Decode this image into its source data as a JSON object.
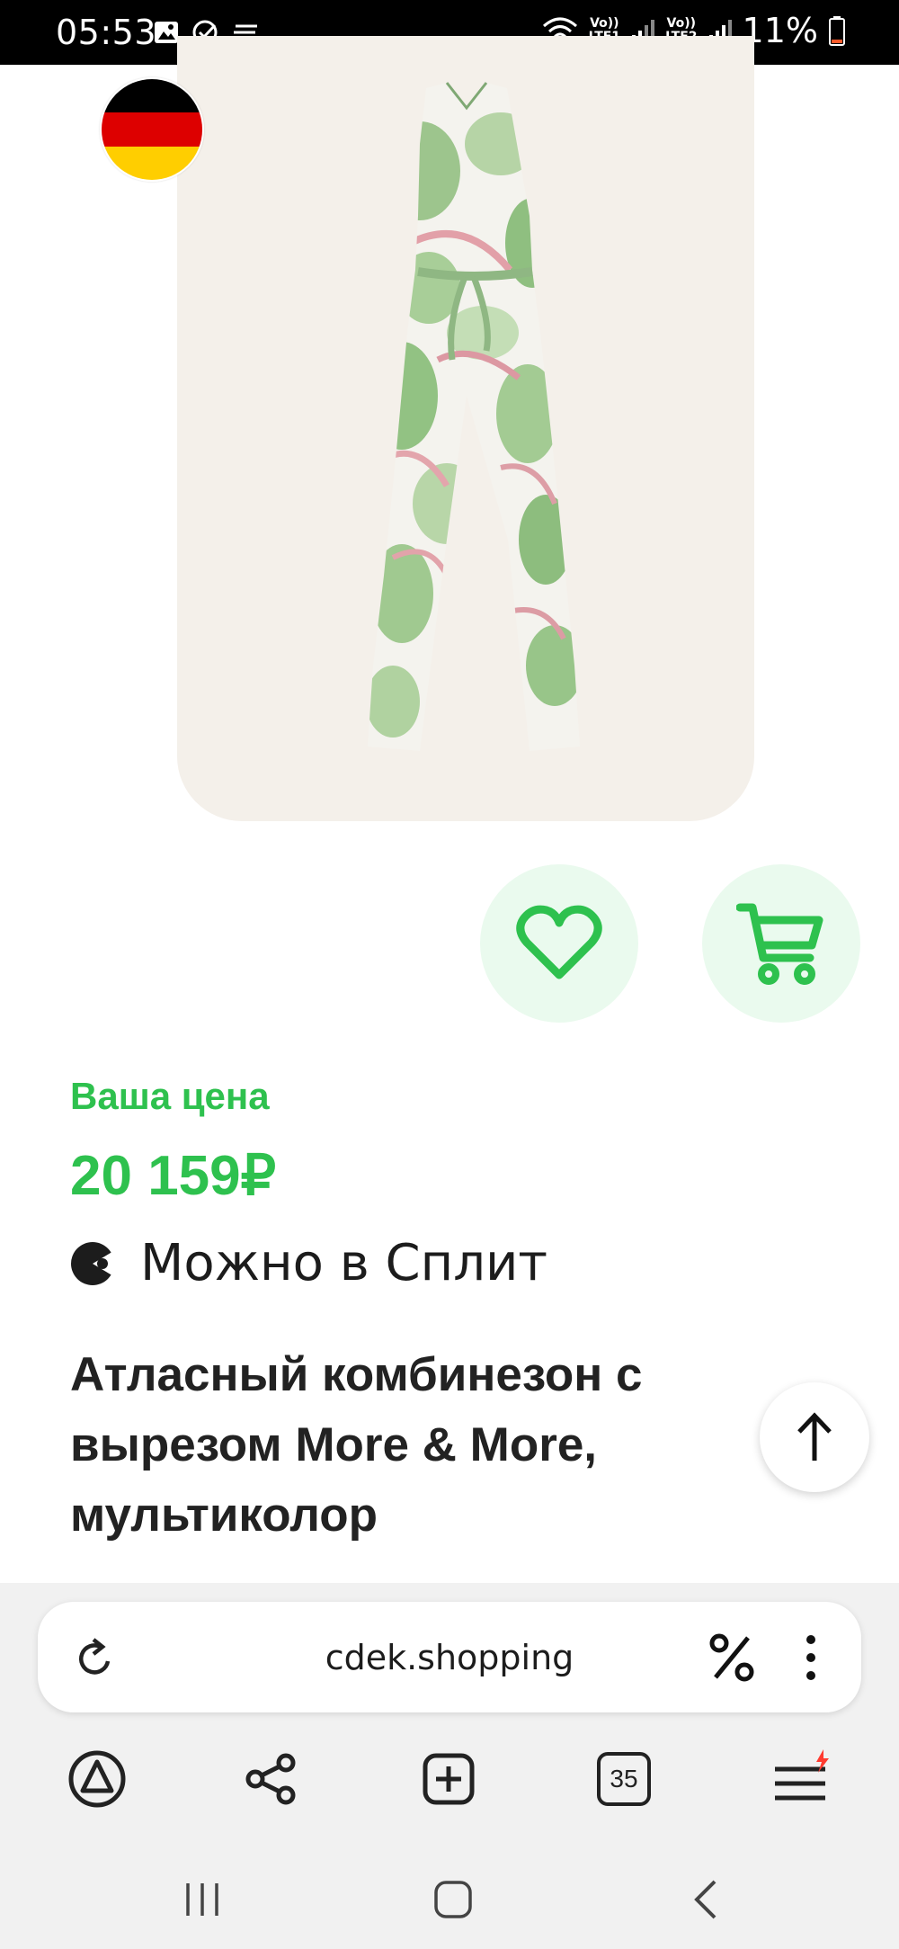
{
  "status_bar": {
    "time": "05:53",
    "battery": "11%",
    "sim1": "LTE1",
    "sim2": "LTE2",
    "volte": "Vo))"
  },
  "product": {
    "price_label": "Ваша цена",
    "price": "20 159₽",
    "split_text": "Можно в Сплит",
    "title": "Атласный комбинезон с вырезом More & More, мультиколор",
    "origin_flag": "germany-flag-icon"
  },
  "browser": {
    "url": "cdek.shopping",
    "tab_count": "35"
  },
  "colors": {
    "accent_green": "#2ec14e",
    "button_bg": "#eafaee",
    "notification_red": "#ff3b30"
  },
  "icons": {
    "favorite": "heart-icon",
    "cart": "cart-icon",
    "split": "split-icon",
    "scroll_top": "arrow-up-icon",
    "reload": "reload-icon",
    "discount": "percent-icon",
    "more": "more-vertical-icon",
    "alice": "alice-icon",
    "share": "share-icon",
    "new_tab": "new-tab-icon",
    "menu": "hamburger-menu-icon"
  }
}
